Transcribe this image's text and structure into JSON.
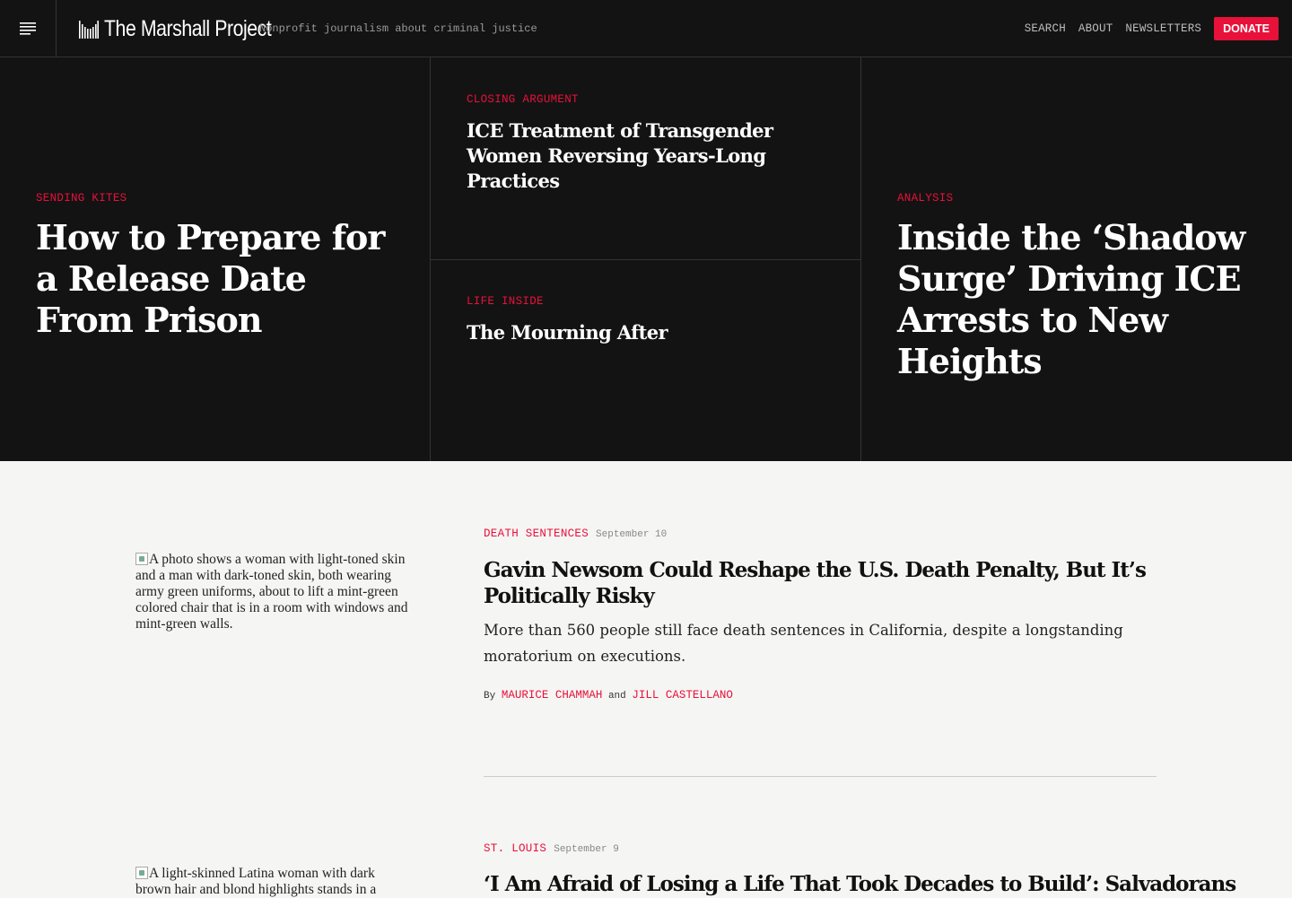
{
  "header": {
    "logo_text": "The Marshall Project",
    "tagline": "Nonprofit journalism about criminal justice",
    "nav": [
      "SEARCH",
      "ABOUT",
      "NEWSLETTERS"
    ],
    "donate_label": "DONATE"
  },
  "hero": {
    "left": {
      "kicker": "SENDING KITES",
      "title": "How to Prepare for a Release Date From Prison"
    },
    "middle_top": {
      "kicker": "CLOSING ARGUMENT",
      "title": "ICE Treatment of Transgender Women Reversing Years-Long Practices"
    },
    "middle_bottom": {
      "kicker": "LIFE INSIDE",
      "title": "The Mourning After"
    },
    "right": {
      "kicker": "ANALYSIS",
      "title": "Inside the ‘Shadow Surge’ Driving ICE Arrests to New Heights"
    }
  },
  "stories": [
    {
      "kicker": "DEATH SENTENCES",
      "date": "September 10",
      "title": "Gavin Newsom Could Reshape the U.S. Death Penalty, But It’s Politically Risky",
      "dek": "More than 560 people still face death sentences in California, despite a longstanding moratorium on executions.",
      "byline_prefix": "By",
      "byline_join": "and",
      "authors": [
        "MAURICE CHAMMAH",
        "JILL CASTELLANO"
      ],
      "image_alt": "A photo shows a woman with light-toned skin and a man with dark-toned skin, both wearing army green uniforms, about to lift a mint-green colored chair that is in a room with windows and mint-green walls."
    },
    {
      "kicker": "ST. LOUIS",
      "date": "September 9",
      "title": "‘I Am Afraid of Losing a Life That Took Decades to Build’: Salvadorans",
      "image_alt": "A light-skinned Latina woman with dark brown hair and blond highlights stands in a"
    }
  ],
  "colors": {
    "accent": "#e8113a",
    "dark_bg": "#131313",
    "light_bg": "#f5f5f3"
  },
  "icons": [
    "hamburger-menu-icon",
    "logo-bars-icon",
    "broken-image-icon"
  ]
}
